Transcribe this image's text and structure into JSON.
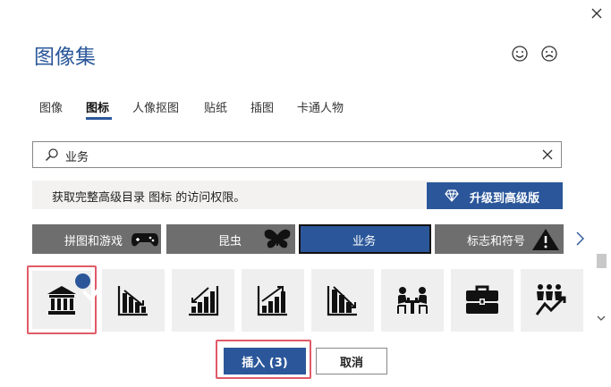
{
  "dialog": {
    "title": "图像集"
  },
  "tabs": [
    {
      "label": "图像"
    },
    {
      "label": "图标",
      "active": true
    },
    {
      "label": "人像抠图"
    },
    {
      "label": "贴纸"
    },
    {
      "label": "插图"
    },
    {
      "label": "卡通人物"
    }
  ],
  "search": {
    "value": "业务",
    "placeholder": ""
  },
  "promo": {
    "text": "获取完整高级目录 图标 的访问权限。",
    "upgrade_label": "升级到高级版"
  },
  "categories": [
    {
      "label": "拼图和游戏",
      "icon": "gamepad-icon"
    },
    {
      "label": "昆虫",
      "icon": "butterfly-icon"
    },
    {
      "label": "业务",
      "selected": true
    },
    {
      "label": "标志和符号",
      "icon": "warning-icon"
    }
  ],
  "icons": [
    {
      "name": "bank-icon",
      "selected": true
    },
    {
      "name": "chart-down-icon"
    },
    {
      "name": "chart-up-icon"
    },
    {
      "name": "chart-growth-icon"
    },
    {
      "name": "chart-decline-icon"
    },
    {
      "name": "meeting-icon"
    },
    {
      "name": "briefcase-icon"
    },
    {
      "name": "team-growth-icon"
    }
  ],
  "buttons": {
    "insert_label": "插入 (3)",
    "cancel_label": "取消"
  },
  "colors": {
    "accent": "#2b579a",
    "category_bg": "#6e6e6e",
    "highlight": "#e05a68"
  }
}
